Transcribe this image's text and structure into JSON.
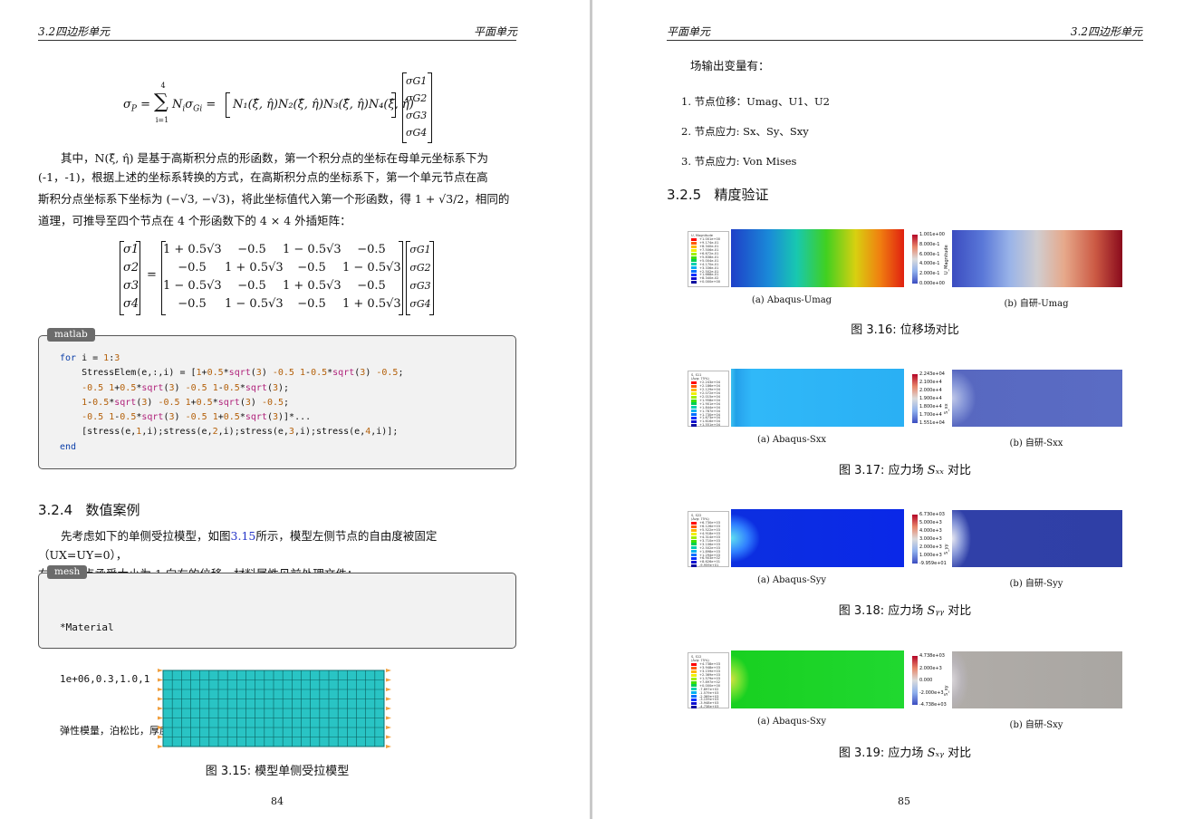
{
  "left": {
    "header_left": "3.2四边形单元",
    "header_right": "平面单元",
    "equation": {
      "lhs": "σ",
      "lhs_sub": "P",
      "sum_top": "4",
      "sum_bottom": "i=1",
      "term": "N",
      "term_sub": "i",
      "sigma_sub": "Gi",
      "row_vector": "N₁(ξ̂, η̂)N₂(ξ̂, η̂)N₃(ξ̂, η̂)N₄(ξ̂, η̂)",
      "col_vector": [
        "σG1",
        "σG2",
        "σG3",
        "σG4"
      ]
    },
    "para1": [
      "其中，N(ξ̂, η̂) 是基于高斯积分点的形函数，第一个积分点的坐标在母单元坐标系下为",
      "(-1，-1)，根据上述的坐标系转换的方式，在高斯积分点的坐标系下，第一个单元节点在高",
      "斯积分点坐标系下坐标为 (−√3, −√3)，将此坐标值代入第一个形函数，得 1 + √3/2，相同的",
      "道理，可推导至四个节点在 4 个形函数下的 4 × 4 外插矩阵："
    ],
    "matrix": {
      "lhs": [
        "σ1",
        "σ2",
        "σ3",
        "σ4"
      ],
      "rows": [
        [
          "1 + 0.5√3",
          "−0.5",
          "1 − 0.5√3",
          "−0.5"
        ],
        [
          "−0.5",
          "1 + 0.5√3",
          "−0.5",
          "1 − 0.5√3"
        ],
        [
          "1 − 0.5√3",
          "−0.5",
          "1 + 0.5√3",
          "−0.5"
        ],
        [
          "−0.5",
          "1 − 0.5√3",
          "−0.5",
          "1 + 0.5√3"
        ]
      ],
      "rhs": [
        "σG1",
        "σG2",
        "σG3",
        "σG4"
      ]
    },
    "code1_tag": "matlab",
    "code1_lines": [
      "for i = 1:3",
      "    StressElem(e,:,i) = [1+0.5*sqrt(3) -0.5 1-0.5*sqrt(3) -0.5;",
      "    -0.5 1+0.5*sqrt(3) -0.5 1-0.5*sqrt(3);",
      "    1-0.5*sqrt(3) -0.5 1+0.5*sqrt(3) -0.5;",
      "    -0.5 1-0.5*sqrt(3) -0.5 1+0.5*sqrt(3)]*...",
      "    [stress(e,1,i);stress(e,2,i);stress(e,3,i);stress(e,4,i)];",
      "end"
    ],
    "section_number": "3.2.4",
    "section_title": "数值案例",
    "para2": [
      "先考虑如下的单侧受拉模型，如图3.15所示，模型左侧节点的自由度被固定（UX=UY=0），",
      "右侧的节点承受大小为 1 向右的位移，材料属性见前处理文件："
    ],
    "para2_ref": "3.15",
    "code2_tag": "mesh",
    "code2_lines": [
      "*Material",
      "1e+06,0.3,1.0,1",
      "弹性模量，泊松比，厚度，平面应力/应变标识"
    ],
    "figure_caption": "图 3.15: 模型单侧受拉模型",
    "page_number": "84"
  },
  "right": {
    "header_left": "平面单元",
    "header_right": "3.2四边形单元",
    "intro": "场输出变量有：",
    "list": [
      "1.  节点位移：Umag、U1、U2",
      "2.  节点应力: Sx、Sy、Sxy",
      "3.  节点应力: Von Mises"
    ],
    "section_number": "3.2.5",
    "section_title": "精度验证",
    "figures": [
      {
        "sub_a": "(a) Abaqus-Umag",
        "sub_b": "(b) 自研-Umag",
        "caption": "图 3.16: 位移场对比",
        "legend_title": [
          "U, Magnitude"
        ],
        "legend_values": [
          "+1.001e+00",
          "+9.174e-01",
          "+8.340e-01",
          "+7.506e-01",
          "+6.672e-01",
          "+5.838e-01",
          "+5.004e-01",
          "+4.170e-01",
          "+3.336e-01",
          "+2.502e-01",
          "+1.668e-01",
          "+8.340e-02",
          "+0.000e+00"
        ],
        "cbar_title": "U_Magnitude",
        "cbar_labels": [
          "1.001e+00",
          "8.000e-1",
          "6.000e-1",
          "4.000e-1",
          "2.000e-1",
          "0.000e+00"
        ],
        "colors": {
          "left_gradient": [
            "#1e3fc8",
            "#1aa0d8",
            "#18c8a0",
            "#40d020",
            "#d8d010",
            "#f08010",
            "#e02010"
          ],
          "right_gradient": [
            "#3b4cc0",
            "#7a9de6",
            "#c8c8cc",
            "#d59476",
            "#b40426",
            "#8b0a1c"
          ]
        }
      },
      {
        "sub_a": "(a) Abaqus-Sxx",
        "sub_b": "(b) 自研-Sxx",
        "caption": "图 3.17: 应力场 ",
        "caption_sym": "Sₓₓ",
        "caption_tail": " 对比",
        "legend_title": [
          "S, S11",
          "(Avg: 75%)"
        ],
        "legend_values": [
          "+2.243e+04",
          "+2.186e+04",
          "+2.129e+04",
          "+2.072e+04",
          "+2.015e+04",
          "+1.958e+04",
          "+1.901e+04",
          "+1.844e+04",
          "+1.787e+04",
          "+1.730e+04",
          "+1.673e+04",
          "+1.616e+04",
          "+1.551e+04"
        ],
        "cbar_title": "S_xx",
        "cbar_labels": [
          "2.243e+04",
          "2.100e+4",
          "2.000e+4",
          "1.900e+4",
          "1.800e+4",
          "1.700e+4",
          "1.551e+04"
        ]
      },
      {
        "sub_a": "(a) Abaqus-Syy",
        "sub_b": "(b) 自研-Syy",
        "caption": "图 3.18: 应力场 ",
        "caption_sym": "Sᵧᵧ",
        "caption_tail": " 对比",
        "legend_title": [
          "S, S22",
          "(Avg: 75%)"
        ],
        "legend_values": [
          "+6.730e+03",
          "+6.126e+03",
          "+5.522e+03",
          "+4.918e+03",
          "+4.314e+03",
          "+3.710e+03",
          "+3.106e+03",
          "+2.502e+03",
          "+1.898e+03",
          "+1.294e+03",
          "+6.903e+02",
          "+8.626e+01",
          "-9.959e+01"
        ],
        "cbar_title": "S_yy",
        "cbar_labels": [
          "6.730e+03",
          "5.000e+3",
          "4.000e+3",
          "3.000e+3",
          "2.000e+3",
          "1.000e+3",
          "-9.959e+01"
        ]
      },
      {
        "sub_a": "(a) Abaqus-Sxy",
        "sub_b": "(b) 自研-Sxy",
        "caption": "图 3.19: 应力场 ",
        "caption_sym": "Sₓᵧ",
        "caption_tail": " 对比",
        "legend_title": [
          "S, S12",
          "(Avg: 75%)"
        ],
        "legend_values": [
          "+4.738e+03",
          "+3.948e+03",
          "+3.159e+03",
          "+2.369e+03",
          "+1.579e+03",
          "+7.897e+02",
          "+0.000e+00",
          "-7.897e+02",
          "-1.579e+03",
          "-2.369e+03",
          "-3.159e+03",
          "-3.948e+03",
          "-4.738e+03"
        ],
        "cbar_title": "S_xy",
        "cbar_labels": [
          "4.738e+03",
          "2.000e+3",
          "0.000",
          "-2.000e+3",
          "-4.738e+03"
        ]
      }
    ],
    "page_number": "85"
  }
}
